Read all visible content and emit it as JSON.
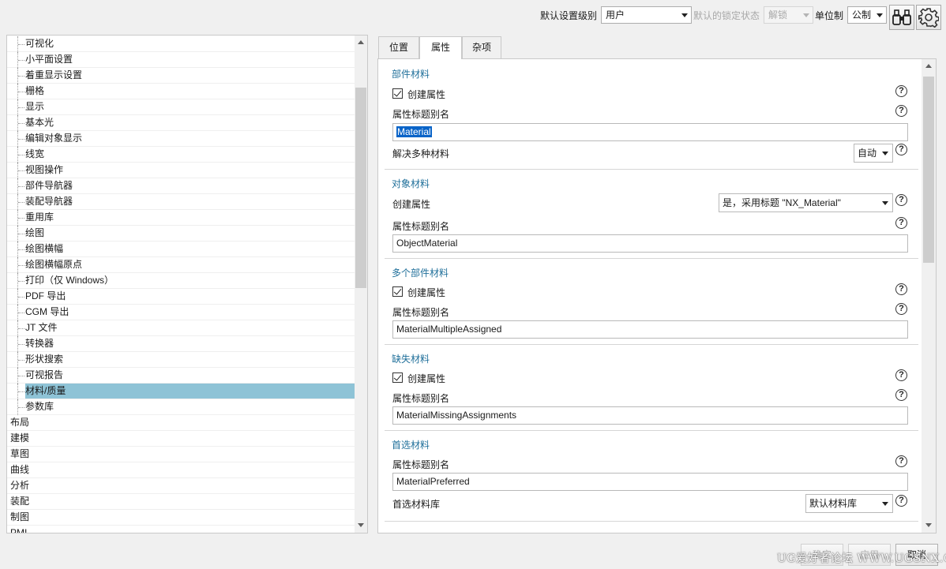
{
  "topbar": {
    "default_level_label": "默认设置级别",
    "default_level_value": "用户",
    "lock_state_label": "默认的锁定状态",
    "lock_state_value": "解锁",
    "unit_label": "单位制",
    "unit_value": "公制"
  },
  "tree": {
    "items": [
      {
        "label": "可视化",
        "level": 1
      },
      {
        "label": "小平面设置",
        "level": 1
      },
      {
        "label": "着重显示设置",
        "level": 1
      },
      {
        "label": "栅格",
        "level": 1
      },
      {
        "label": "显示",
        "level": 1
      },
      {
        "label": "基本光",
        "level": 1
      },
      {
        "label": "编辑对象显示",
        "level": 1
      },
      {
        "label": "线宽",
        "level": 1
      },
      {
        "label": "视图操作",
        "level": 1
      },
      {
        "label": "部件导航器",
        "level": 1
      },
      {
        "label": "装配导航器",
        "level": 1
      },
      {
        "label": "重用库",
        "level": 1
      },
      {
        "label": "绘图",
        "level": 1
      },
      {
        "label": "绘图横幅",
        "level": 1
      },
      {
        "label": "绘图横幅原点",
        "level": 1
      },
      {
        "label": "打印（仅 Windows）",
        "level": 1
      },
      {
        "label": "PDF 导出",
        "level": 1
      },
      {
        "label": "CGM 导出",
        "level": 1
      },
      {
        "label": "JT 文件",
        "level": 1
      },
      {
        "label": "转换器",
        "level": 1
      },
      {
        "label": "形状搜索",
        "level": 1
      },
      {
        "label": "可视报告",
        "level": 1
      },
      {
        "label": "材料/质量",
        "level": 1,
        "selected": true
      },
      {
        "label": "参数库",
        "level": 1
      },
      {
        "label": "布局",
        "level": 0
      },
      {
        "label": "建模",
        "level": 0
      },
      {
        "label": "草图",
        "level": 0
      },
      {
        "label": "曲线",
        "level": 0
      },
      {
        "label": "分析",
        "level": 0
      },
      {
        "label": "装配",
        "level": 0
      },
      {
        "label": "制图",
        "level": 0
      },
      {
        "label": "PMI",
        "level": 0
      }
    ]
  },
  "tabs": [
    {
      "label": "位置",
      "active": false
    },
    {
      "label": "属性",
      "active": true
    },
    {
      "label": "杂项",
      "active": false
    }
  ],
  "panel": {
    "part_material": {
      "title": "部件材料",
      "create_attr_label": "创建属性",
      "alias_label": "属性标题别名",
      "alias_value": "Material",
      "resolve_label": "解决多种材料",
      "resolve_value": "自动"
    },
    "object_material": {
      "title": "对象材料",
      "create_attr_label": "创建属性",
      "create_attr_value": "是，采用标题 \"NX_Material\"",
      "alias_label": "属性标题别名",
      "alias_value": "ObjectMaterial"
    },
    "multi_part_material": {
      "title": "多个部件材料",
      "create_attr_label": "创建属性",
      "alias_label": "属性标题别名",
      "alias_value": "MaterialMultipleAssigned"
    },
    "missing_material": {
      "title": "缺失材料",
      "create_attr_label": "创建属性",
      "alias_label": "属性标题别名",
      "alias_value": "MaterialMissingAssignments"
    },
    "preferred_material": {
      "title": "首选材料",
      "alias_label": "属性标题别名",
      "alias_value": "MaterialPreferred",
      "library_label": "首选材料库",
      "library_value": "默认材料库"
    },
    "help_glyph": "?"
  },
  "buttons": {
    "ok": "确定",
    "apply": "应用",
    "cancel": "取消"
  },
  "watermark": "UG爱好者论坛 WWW.UGSNX.COM"
}
